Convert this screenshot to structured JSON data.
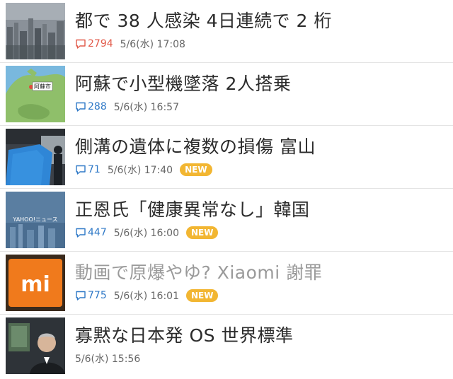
{
  "colors": {
    "comment_hot": "#e25b4b",
    "comment": "#2f79c7",
    "badge": "#f2b632",
    "headline": "#2b2b2b",
    "headline_visited": "#9a9a9a"
  },
  "articles": [
    {
      "headline": "都で 38 人感染 4日連続で 2 桁",
      "comments": "2794",
      "comments_hot": true,
      "time": "5/6(水) 17:08",
      "badge": "",
      "visited": false,
      "thumb_icon": "city-skyline-photo"
    },
    {
      "headline": "阿蘇で小型機墜落 2人搭乗",
      "comments": "288",
      "comments_hot": false,
      "time": "5/6(水) 16:57",
      "badge": "",
      "visited": false,
      "thumb_icon": "map-photo",
      "thumb_label": "阿蘇市"
    },
    {
      "headline": "側溝の遺体に複数の損傷 富山",
      "comments": "71",
      "comments_hot": false,
      "time": "5/6(水) 17:40",
      "badge": "NEW",
      "visited": false,
      "thumb_icon": "blue-tarp-scene-photo"
    },
    {
      "headline": "正恩氏「健康異常なし」韓国",
      "comments": "447",
      "comments_hot": false,
      "time": "5/6(水) 16:00",
      "badge": "NEW",
      "visited": false,
      "thumb_icon": "yahoo-news-placeholder",
      "thumb_label": "YAHOO!ニュース"
    },
    {
      "headline": "動画で原爆やゆ? Xiaomi 謝罪",
      "comments": "775",
      "comments_hot": false,
      "time": "5/6(水) 16:01",
      "badge": "NEW",
      "visited": true,
      "thumb_icon": "xiaomi-logo",
      "thumb_label": "mi"
    },
    {
      "headline": "寡黙な日本発 OS 世界標準",
      "comments": "",
      "comments_hot": false,
      "time": "5/6(水) 15:56",
      "badge": "",
      "visited": false,
      "thumb_icon": "portrait-photo"
    }
  ]
}
